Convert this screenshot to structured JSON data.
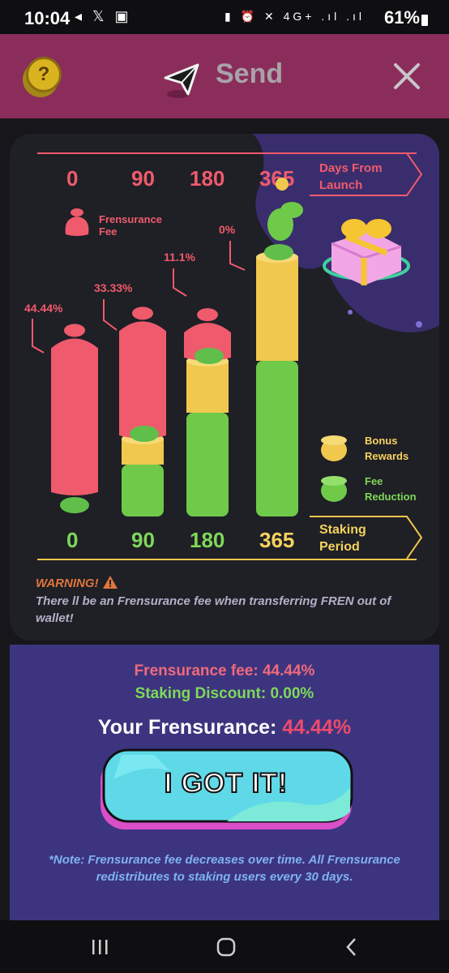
{
  "status_bar": {
    "time": "10:04",
    "left_icons": "◂ 𝕏 ▣",
    "right_icons": "▮ ⏰ ✕ 4G+ .ıl .ıl",
    "battery": "61%"
  },
  "header": {
    "help_label": "?",
    "title": "Send",
    "accent": "#8b2d5b"
  },
  "chart": {
    "days_label_line1": "Days From",
    "days_label_line2": "Launch",
    "days": [
      "0",
      "90",
      "180",
      "365"
    ],
    "fee_legend_line1": "Frensurance",
    "fee_legend_line2": "Fee",
    "percentages": [
      "44.44%",
      "33.33%",
      "11.1%",
      "0%"
    ],
    "legend": [
      {
        "line1": "Bonus",
        "line2": "Rewards",
        "color": "#f0c84e"
      },
      {
        "line1": "Fee",
        "line2": "Reduction",
        "color": "#7ed957"
      }
    ],
    "staking_days": [
      "0",
      "90",
      "180",
      "365"
    ],
    "staking_label_line1": "Staking",
    "staking_label_line2": "Period"
  },
  "chart_data": {
    "type": "bar",
    "categories": [
      "0",
      "90",
      "180",
      "365"
    ],
    "series": [
      {
        "name": "Frensurance Fee",
        "values": [
          44.44,
          33.33,
          11.1,
          0
        ]
      },
      {
        "name": "Fee Reduction",
        "values": [
          0,
          1,
          2,
          3
        ]
      },
      {
        "name": "Bonus Rewards",
        "values": [
          0,
          0.5,
          1,
          2
        ]
      }
    ],
    "xlabel": "Staking Period",
    "ylabel": ""
  },
  "warning": {
    "title": "WARNING!",
    "text": "There ll be an Frensurance fee when transferring FREN out of wallet!"
  },
  "summary": {
    "fee_line": "Frensurance fee: 44.44%",
    "discount_line": "Staking Discount: 0.00%",
    "your_label": "Your Frensurance:",
    "your_value": "44.44%",
    "button_label": "I GOT IT!",
    "note": "*Note: Frensurance fee decreases over time. All Frensurance redistributes to staking users every 30 days."
  }
}
